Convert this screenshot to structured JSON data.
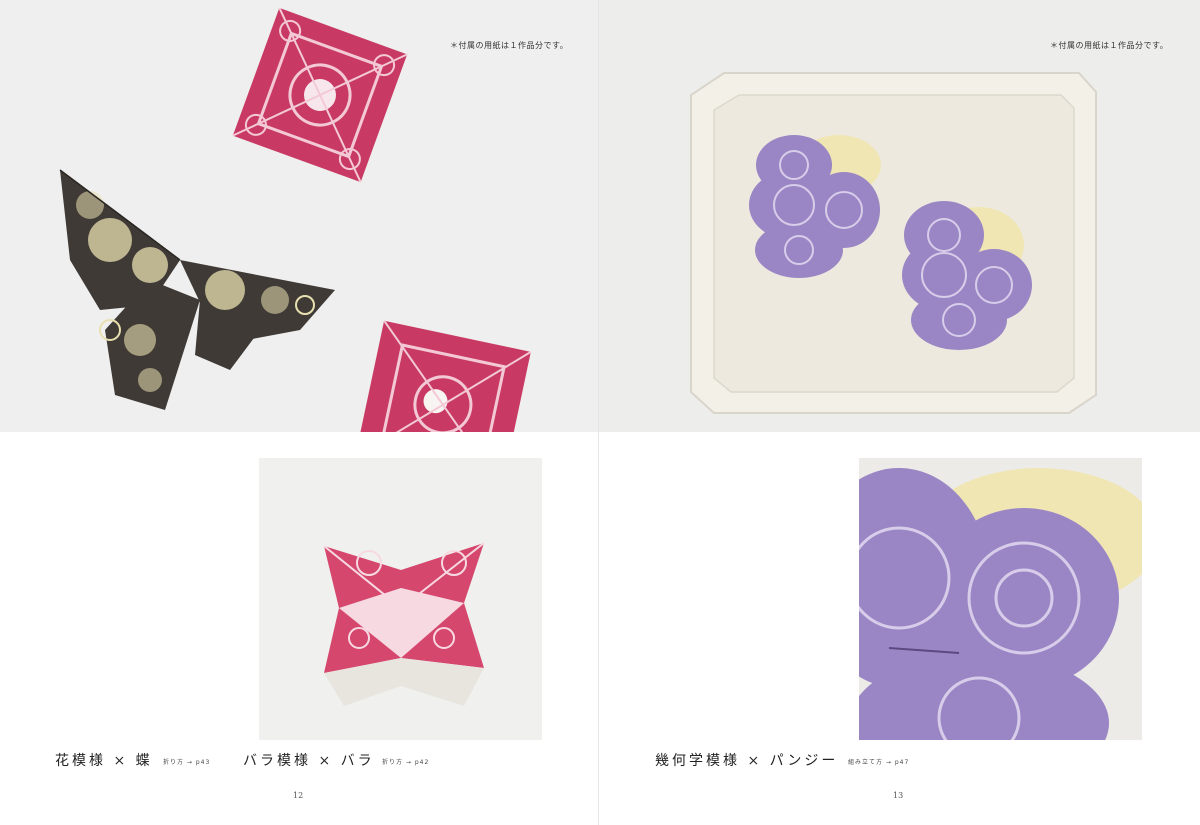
{
  "notes": {
    "left": "＊付属の用紙は１作品分です。",
    "right": "＊付属の用紙は１作品分です。"
  },
  "captions": [
    {
      "title": "花模様 × 蝶",
      "ref": "折り方 → p43"
    },
    {
      "title": "バラ模様 × バラ",
      "ref": "折り方 → p42"
    },
    {
      "title": "幾何学模様 × パンジー",
      "ref": "組み立て方 → p47"
    }
  ],
  "folios": {
    "left": "12",
    "right": "13"
  },
  "colors": {
    "rose_pink": "#c83a64",
    "butterfly_dark": "#3f3a36",
    "butterfly_accent": "#e9e0b0",
    "pansy_purple": "#9a86c4",
    "pansy_yellow": "#f0e6b4",
    "tray": "#f3f0e8"
  }
}
